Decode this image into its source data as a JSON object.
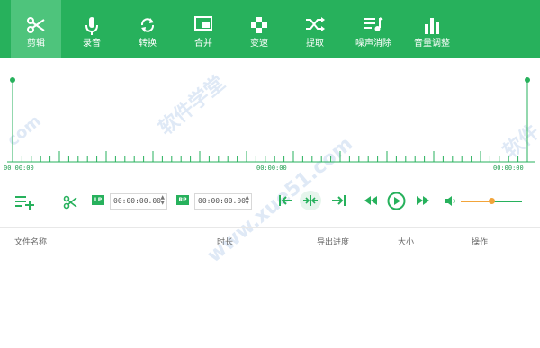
{
  "toolbar": {
    "accent": "#27b15c",
    "items": [
      {
        "label": "剪辑",
        "icon": "scissors-icon",
        "active": true
      },
      {
        "label": "录音",
        "icon": "microphone-icon"
      },
      {
        "label": "转换",
        "icon": "convert-icon"
      },
      {
        "label": "合并",
        "icon": "merge-icon"
      },
      {
        "label": "变速",
        "icon": "speed-icon"
      },
      {
        "label": "提取",
        "icon": "extract-icon"
      },
      {
        "label": "噪声消除",
        "icon": "noise-removal-icon"
      },
      {
        "label": "音量调整",
        "icon": "volume-adjust-icon"
      }
    ]
  },
  "timeline": {
    "start": "00:00:00",
    "middle": "00:00:00",
    "end": "00:00:00"
  },
  "controls": {
    "lp_label": "LP",
    "rp_label": "RP",
    "start_time": "00:00:00.00",
    "end_time": "00:00:00.00",
    "volume_fraction": 0.5
  },
  "table": {
    "headers": [
      "文件名称",
      "时长",
      "导出进度",
      "大小",
      "操作"
    ]
  },
  "watermark": {
    "text1": "软件学堂",
    "text2": "www.xue51.com",
    "text3": "com",
    "text4": "软件"
  }
}
